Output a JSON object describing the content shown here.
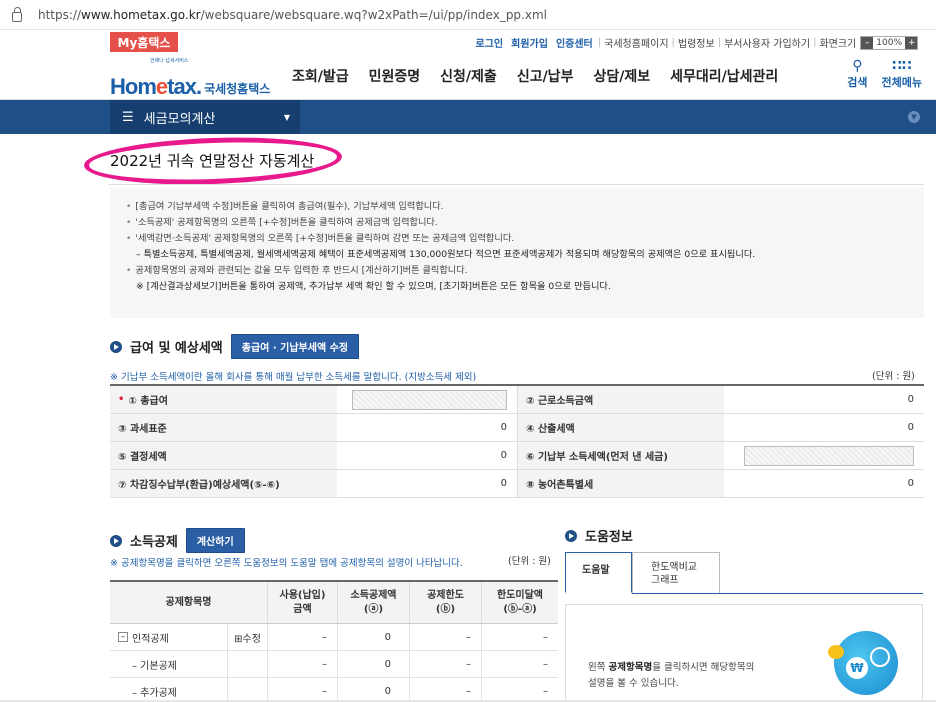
{
  "browser": {
    "url_prefix": "https://",
    "url_host": "www.hometax.go.kr",
    "url_path": "/websquare/websquare.wq?w2xPath=/ui/pp/index_pp.xml"
  },
  "util": {
    "mytax": "My홈택스",
    "links_blue": [
      "로그인",
      "회원가입",
      "인증센터"
    ],
    "links": [
      "국세청홈페이지",
      "법령정보",
      "부서사용자 가입하기",
      "화면크기"
    ],
    "zoom": "100%"
  },
  "header": {
    "logo_small": "언제나 납세서비스",
    "logo_text_a": "Hom",
    "logo_text_b": "e",
    "logo_text_c": "tax.",
    "logo_kr": "국세청홈택스",
    "gnb": [
      "조회/발급",
      "민원증명",
      "신청/제출",
      "신고/납부",
      "상담/제보",
      "세무대리/납세관리"
    ],
    "search_label": "검색",
    "menu_label": "전체메뉴"
  },
  "menubar": {
    "label": "세금모의계산"
  },
  "page": {
    "title": "2022년 귀속 연말정산 자동계산"
  },
  "guide": [
    "[총급여 기납부세액 수정]버튼을 클릭하여 총급여(필수), 기납부세액 입력합니다.",
    "'소득공제' 공제항목명의 오른쪽 [+수정]버튼을 클릭하여 공제금액 입력합니다.",
    "'세액감면·소득공제' 공제항목명의 오른쪽 [+수정]버튼을 클릭하여 감면 또는 공제금액 입력합니다.",
    "– 특별소득공제, 특별세액공제, 월세액세액공제 혜택이 표준세액공제액 130,000원보다 적으면 표준세액공제가 적용되며 해당항목의 공제액은 0으로 표시됩니다.",
    "공제항목명의 공제와 관련되는 값을 모두 입력한 후 반드시 [계산하기]버튼 클릭합니다.",
    "※ [계산결과상세보기]버튼을 통하여 공제액, 추가납부 세액 확인 할 수 있으며, [초기화]버튼은 모든 항목을 0으로 만듭니다."
  ],
  "salary": {
    "heading": "급여 및 예상세액",
    "edit_button": "총급여 · 기납부세액 수정",
    "note": "※ 기납부 소득세액이란 올해 회사를 통해 매월 납부한 소득세를 말합니다. (지방소득세 제외)",
    "unit": "(단위 : 원)",
    "rows": [
      {
        "l1": "① 총급여",
        "v1": "",
        "l2": "② 근로소득금액",
        "v2": "0"
      },
      {
        "l1": "③ 과세표준",
        "v1": "0",
        "l2": "④ 산출세액",
        "v2": "0"
      },
      {
        "l1": "⑤ 결정세액",
        "v1": "0",
        "l2": "⑥ 기납부 소득세액(먼저 낸 세금)",
        "v2": ""
      },
      {
        "l1": "⑦ 차감징수납부(환급)예상세액(⑤-⑥)",
        "v1": "0",
        "l2": "⑧ 농어촌특별세",
        "v2": "0"
      }
    ]
  },
  "deduction": {
    "heading": "소득공제",
    "calc_button": "계산하기",
    "note": "※ 공제항목명을 클릭하면 오른쪽 도움정보의 도움말 탭에 공제항목의 설명이 나타납니다.",
    "unit": "(단위 : 원)",
    "headers": [
      "공제항목명",
      "사용(납입)\n금액",
      "소득공제액\n(ⓐ)",
      "공제한도\n(ⓑ)",
      "한도미달액\n(ⓑ-ⓐ)"
    ],
    "rows": [
      {
        "name": "인적공제",
        "edit": "⊞수정",
        "use": "–",
        "amount": "0",
        "limit": "–",
        "gap": "–"
      },
      {
        "name": "– 기본공제",
        "edit": "",
        "use": "–",
        "amount": "0",
        "limit": "–",
        "gap": "–"
      },
      {
        "name": "– 추가공제",
        "edit": "",
        "use": "–",
        "amount": "0",
        "limit": "–",
        "gap": "–"
      }
    ]
  },
  "help": {
    "heading": "도움정보",
    "tab1": "도움말",
    "tab2_line1": "한도액비교",
    "tab2_line2": "그래프",
    "text_pre": "왼쪽 ",
    "text_bold": "공제항목명",
    "text_post": "을 클릭하시면 해당항목의",
    "text_line2": "설명을 볼 수 있습니다."
  }
}
